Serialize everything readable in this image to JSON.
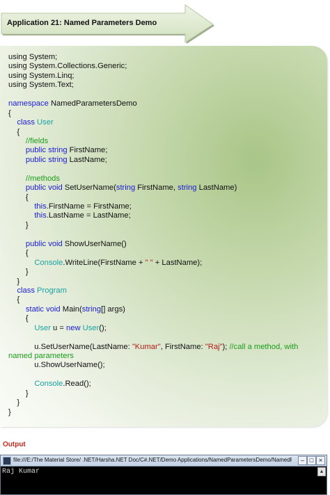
{
  "banner": {
    "title": "Application 21: Named Parameters Demo"
  },
  "code_lines": [
    [
      {
        "t": "using System;",
        "c": "ln"
      }
    ],
    [
      {
        "t": "using System.Collections.Generic;",
        "c": "ln"
      }
    ],
    [
      {
        "t": "using System.Linq;",
        "c": "ln"
      }
    ],
    [
      {
        "t": "using System.Text;",
        "c": "ln"
      }
    ],
    [
      {
        "t": "",
        "c": "ln"
      }
    ],
    [
      {
        "t": "namespace",
        "c": "kw"
      },
      {
        "t": " NamedParametersDemo",
        "c": "ln"
      }
    ],
    [
      {
        "t": "{",
        "c": "ln"
      }
    ],
    [
      {
        "t": "    ",
        "c": "ln"
      },
      {
        "t": "class",
        "c": "kw"
      },
      {
        "t": " ",
        "c": "ln"
      },
      {
        "t": "User",
        "c": "ty"
      }
    ],
    [
      {
        "t": "    {",
        "c": "ln"
      }
    ],
    [
      {
        "t": "        ",
        "c": "ln"
      },
      {
        "t": "//fields",
        "c": "cm"
      }
    ],
    [
      {
        "t": "        ",
        "c": "ln"
      },
      {
        "t": "public",
        "c": "kw"
      },
      {
        "t": " ",
        "c": "ln"
      },
      {
        "t": "string",
        "c": "kw"
      },
      {
        "t": " FirstName;",
        "c": "ln"
      }
    ],
    [
      {
        "t": "        ",
        "c": "ln"
      },
      {
        "t": "public",
        "c": "kw"
      },
      {
        "t": " ",
        "c": "ln"
      },
      {
        "t": "string",
        "c": "kw"
      },
      {
        "t": " LastName;",
        "c": "ln"
      }
    ],
    [
      {
        "t": "",
        "c": "ln"
      }
    ],
    [
      {
        "t": "        ",
        "c": "ln"
      },
      {
        "t": "//methods",
        "c": "cm"
      }
    ],
    [
      {
        "t": "        ",
        "c": "ln"
      },
      {
        "t": "public",
        "c": "kw"
      },
      {
        "t": " ",
        "c": "ln"
      },
      {
        "t": "void",
        "c": "kw"
      },
      {
        "t": " SetUserName(",
        "c": "ln"
      },
      {
        "t": "string",
        "c": "kw"
      },
      {
        "t": " FirstName, ",
        "c": "ln"
      },
      {
        "t": "string",
        "c": "kw"
      },
      {
        "t": " LastName)",
        "c": "ln"
      }
    ],
    [
      {
        "t": "        {",
        "c": "ln"
      }
    ],
    [
      {
        "t": "            ",
        "c": "ln"
      },
      {
        "t": "this",
        "c": "kw"
      },
      {
        "t": ".FirstName = FirstName;",
        "c": "ln"
      }
    ],
    [
      {
        "t": "            ",
        "c": "ln"
      },
      {
        "t": "this",
        "c": "kw"
      },
      {
        "t": ".LastName = LastName;",
        "c": "ln"
      }
    ],
    [
      {
        "t": "        }",
        "c": "ln"
      }
    ],
    [
      {
        "t": "",
        "c": "ln"
      }
    ],
    [
      {
        "t": "        ",
        "c": "ln"
      },
      {
        "t": "public",
        "c": "kw"
      },
      {
        "t": " ",
        "c": "ln"
      },
      {
        "t": "void",
        "c": "kw"
      },
      {
        "t": " ShowUserName()",
        "c": "ln"
      }
    ],
    [
      {
        "t": "        {",
        "c": "ln"
      }
    ],
    [
      {
        "t": "            ",
        "c": "ln"
      },
      {
        "t": "Console",
        "c": "ty"
      },
      {
        "t": ".WriteLine(FirstName + ",
        "c": "ln"
      },
      {
        "t": "\" \"",
        "c": "st"
      },
      {
        "t": " + LastName);",
        "c": "ln"
      }
    ],
    [
      {
        "t": "        }",
        "c": "ln"
      }
    ],
    [
      {
        "t": "    }",
        "c": "ln"
      }
    ],
    [
      {
        "t": "    ",
        "c": "ln"
      },
      {
        "t": "class",
        "c": "kw"
      },
      {
        "t": " ",
        "c": "ln"
      },
      {
        "t": "Program",
        "c": "ty"
      }
    ],
    [
      {
        "t": "    {",
        "c": "ln"
      }
    ],
    [
      {
        "t": "        ",
        "c": "ln"
      },
      {
        "t": "static",
        "c": "kw"
      },
      {
        "t": " ",
        "c": "ln"
      },
      {
        "t": "void",
        "c": "kw"
      },
      {
        "t": " Main(",
        "c": "ln"
      },
      {
        "t": "string",
        "c": "kw"
      },
      {
        "t": "[] args)",
        "c": "ln"
      }
    ],
    [
      {
        "t": "        {",
        "c": "ln"
      }
    ],
    [
      {
        "t": "            ",
        "c": "ln"
      },
      {
        "t": "User",
        "c": "ty"
      },
      {
        "t": " u = ",
        "c": "ln"
      },
      {
        "t": "new",
        "c": "kw"
      },
      {
        "t": " ",
        "c": "ln"
      },
      {
        "t": "User",
        "c": "ty"
      },
      {
        "t": "();",
        "c": "ln"
      }
    ],
    [
      {
        "t": "",
        "c": "ln"
      }
    ],
    [
      {
        "t": "            u.SetUserName(LastName: ",
        "c": "ln"
      },
      {
        "t": "\"Kumar\"",
        "c": "st"
      },
      {
        "t": ", FirstName: ",
        "c": "ln"
      },
      {
        "t": "\"Raj\"",
        "c": "st"
      },
      {
        "t": "); ",
        "c": "ln"
      },
      {
        "t": "//call a method, with",
        "c": "cm"
      }
    ],
    [
      {
        "t": "named parameters",
        "c": "cm"
      }
    ],
    [
      {
        "t": "            u.ShowUserName();",
        "c": "ln"
      }
    ],
    [
      {
        "t": "",
        "c": "ln"
      }
    ],
    [
      {
        "t": "            ",
        "c": "ln"
      },
      {
        "t": "Console",
        "c": "ty"
      },
      {
        "t": ".Read();",
        "c": "ln"
      }
    ],
    [
      {
        "t": "        }",
        "c": "ln"
      }
    ],
    [
      {
        "t": "    }",
        "c": "ln"
      }
    ],
    [
      {
        "t": "}",
        "c": "ln"
      }
    ]
  ],
  "output": {
    "label": "Output",
    "console_title": "file:///E:/The Material Store/ .NET/Harsha.NET Doc/C#.NET/Demo Applications/NamedParametersDemo/NamedParame...",
    "console_text": "Raj Kumar",
    "buttons": {
      "minimize": "–",
      "maximize": "□",
      "close": "×"
    },
    "scroll_up": "▲"
  },
  "colors": {
    "keyword": "#1a1ad8",
    "type": "#1aa3a3",
    "comment": "#1a9c1a",
    "string": "#b21a1a",
    "output_label": "#c0281e",
    "banner_fill": "#e3ecd5"
  }
}
